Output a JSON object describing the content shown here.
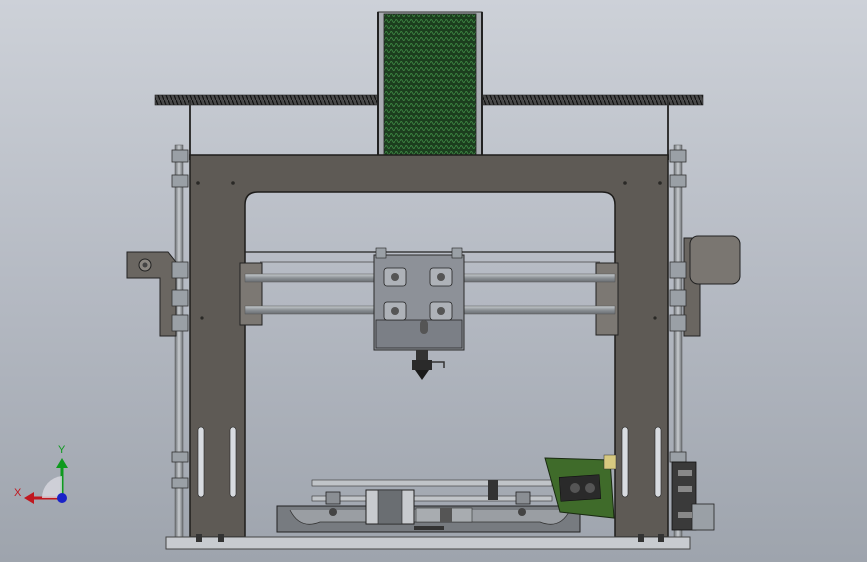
{
  "view": {
    "background_top": "#cdd1d8",
    "background_bottom": "#9ea4ad"
  },
  "colors": {
    "frame": "#5e5a55",
    "frame_edge": "#2b2a28",
    "rod": "#9ea3a8",
    "threaded_rod": "#3e3e3e",
    "carriage": "#8e9299",
    "filament": "#1f4a22",
    "pcb": "#3f6b2a",
    "base": "#c9ccd1",
    "bed": "#777b80"
  },
  "triad": {
    "x_label": "X",
    "y_label": "Y",
    "x_color": "#c0181f",
    "y_color": "#0e9a1e",
    "z_color": "#1a22c8"
  }
}
